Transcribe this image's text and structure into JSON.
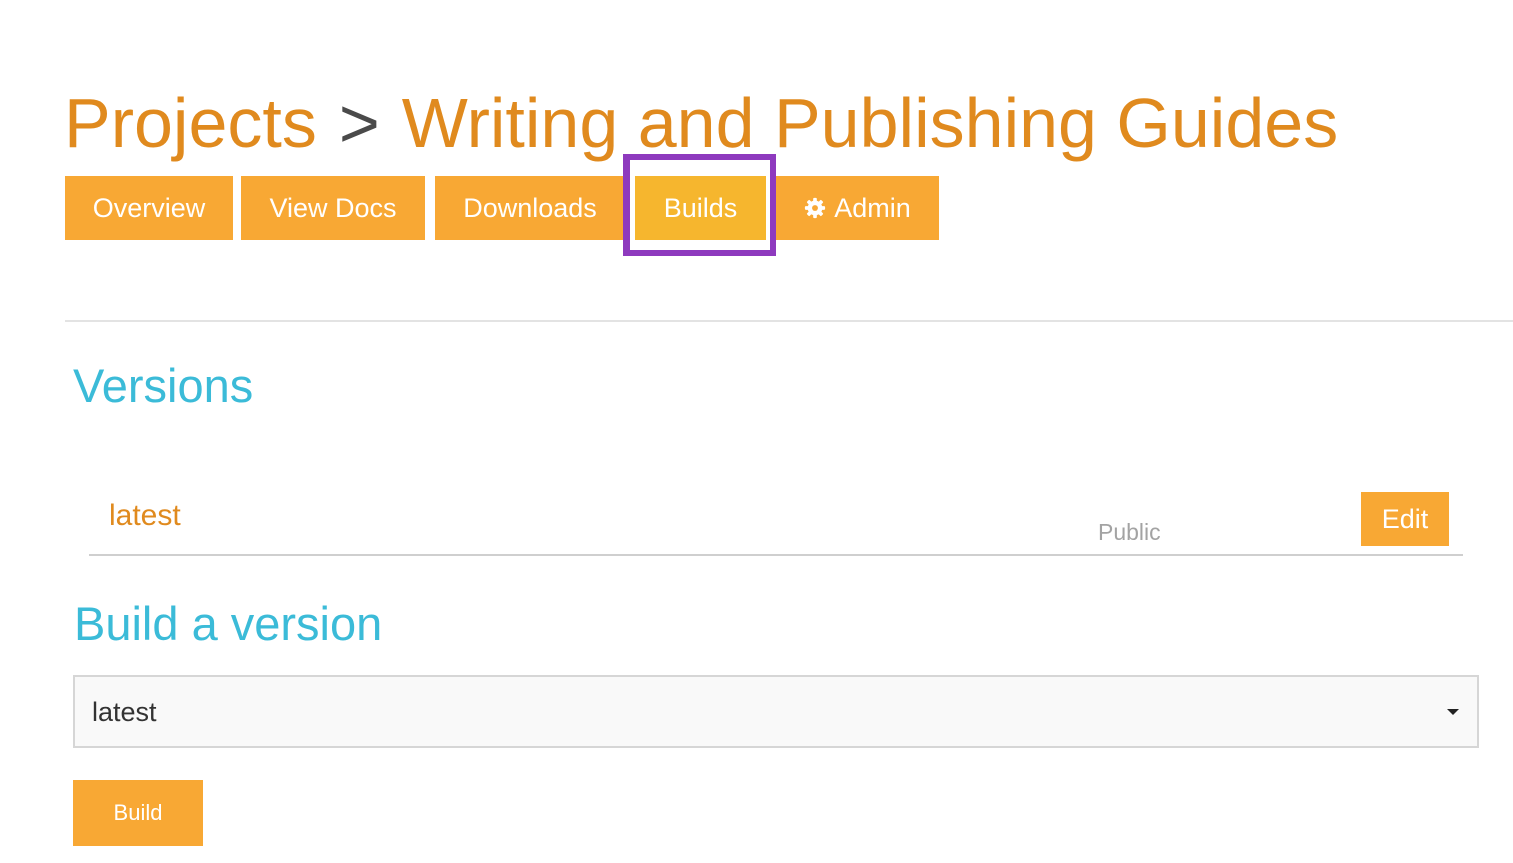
{
  "breadcrumb": {
    "root": "Projects",
    "separator": ">",
    "current": "Writing and Publishing Guides"
  },
  "tabs": [
    {
      "label": "Overview"
    },
    {
      "label": "View Docs"
    },
    {
      "label": "Downloads"
    },
    {
      "label": "Builds",
      "active": true
    },
    {
      "label": "Admin",
      "icon": "gear-icon"
    }
  ],
  "versions": {
    "title": "Versions",
    "items": [
      {
        "name": "latest",
        "privacy": "Public",
        "edit_label": "Edit"
      }
    ]
  },
  "build": {
    "title": "Build a version",
    "select": {
      "selected": "latest"
    },
    "button_label": "Build"
  },
  "colors": {
    "accent": "#f8a834",
    "link": "#e08a1e",
    "heading": "#3bbbd8",
    "highlight": "#8e3abe"
  }
}
